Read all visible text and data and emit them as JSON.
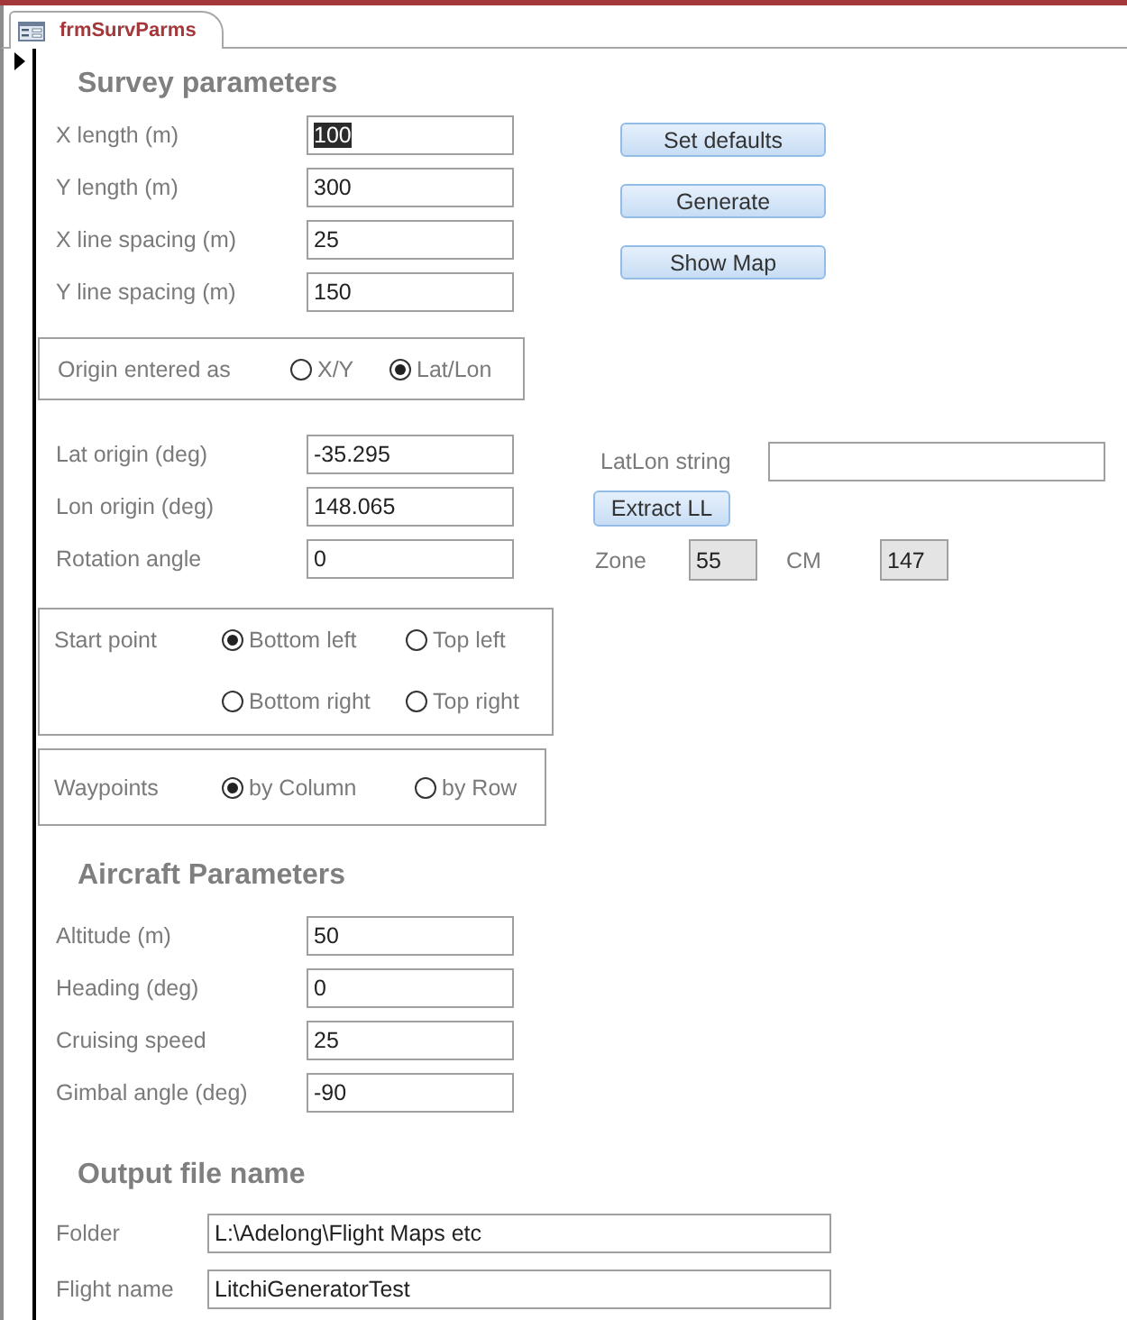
{
  "tab": {
    "title": "frmSurvParms"
  },
  "survey": {
    "heading": "Survey parameters",
    "fields": [
      {
        "label": "X length (m)",
        "value": "100",
        "text_selected": true
      },
      {
        "label": "Y length (m)",
        "value": "300",
        "text_selected": false
      },
      {
        "label": "X line spacing (m)",
        "value": "25",
        "text_selected": false
      },
      {
        "label": "Y line spacing (m)",
        "value": "150",
        "text_selected": false
      }
    ]
  },
  "buttons": [
    "Set defaults",
    "Generate",
    "Show Map"
  ],
  "origin_entry": {
    "label": "Origin entered as",
    "options": [
      {
        "label": "X/Y",
        "selected": false
      },
      {
        "label": "Lat/Lon",
        "selected": true
      }
    ]
  },
  "origin": {
    "fields": [
      {
        "label": "Lat origin (deg)",
        "value": "-35.295",
        "text_selected": false
      },
      {
        "label": "Lon origin (deg)",
        "value": "148.065",
        "text_selected": false
      },
      {
        "label": "Rotation angle",
        "value": "0",
        "text_selected": false
      }
    ]
  },
  "latlon": {
    "label": "LatLon string",
    "button": "Extract LL",
    "readouts": [
      {
        "label": "Zone",
        "value": "55",
        "locked": true
      },
      {
        "label": "CM",
        "value": "147",
        "locked": true
      }
    ]
  },
  "start_point": {
    "label": "Start point",
    "options": [
      {
        "label": "Bottom left",
        "selected": true
      },
      {
        "label": "Top left",
        "selected": false
      },
      {
        "label": "Bottom right",
        "selected": false
      },
      {
        "label": "Top right",
        "selected": false
      }
    ]
  },
  "waypoints": {
    "label": "Waypoints",
    "options": [
      {
        "label": "by Column",
        "selected": true
      },
      {
        "label": "by Row",
        "selected": false
      }
    ]
  },
  "aircraft": {
    "heading": "Aircraft Parameters",
    "fields": [
      {
        "label": "Altitude (m)",
        "value": "50",
        "text_selected": false
      },
      {
        "label": "Heading (deg)",
        "value": "0",
        "text_selected": false
      },
      {
        "label": "Cruising speed",
        "value": "25",
        "text_selected": false
      },
      {
        "label": "Gimbal angle (deg)",
        "value": "-90",
        "text_selected": false
      }
    ]
  },
  "output": {
    "heading": "Output file name",
    "fields": [
      {
        "label": "Folder",
        "value": "L:\\Adelong\\Flight Maps etc",
        "text_selected": false
      },
      {
        "label": "Flight name",
        "value": "LitchiGeneratorTest",
        "text_selected": false
      }
    ]
  }
}
